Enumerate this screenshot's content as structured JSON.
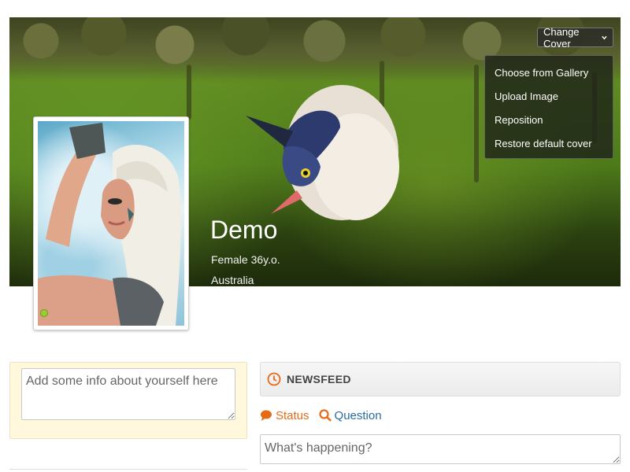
{
  "cover": {
    "change_cover_label": "Change Cover",
    "menu_items": [
      "Choose from Gallery",
      "Upload Image",
      "Reposition",
      "Restore default cover"
    ]
  },
  "profile": {
    "name": "Demo",
    "gender_age": "Female 36y.o.",
    "location": "Australia",
    "online_status_color": "#9acd32"
  },
  "about": {
    "placeholder": "Add some info about yourself here"
  },
  "newsfeed": {
    "title": "NEWSFEED",
    "title_icon": "clock-icon",
    "tabs": [
      {
        "label": "Status",
        "icon": "speech-bubble-icon",
        "color": "#e56b17"
      },
      {
        "label": "Question",
        "icon": "magnifier-icon",
        "color": "#2a6aa3"
      }
    ],
    "status_placeholder": "What's happening?"
  }
}
